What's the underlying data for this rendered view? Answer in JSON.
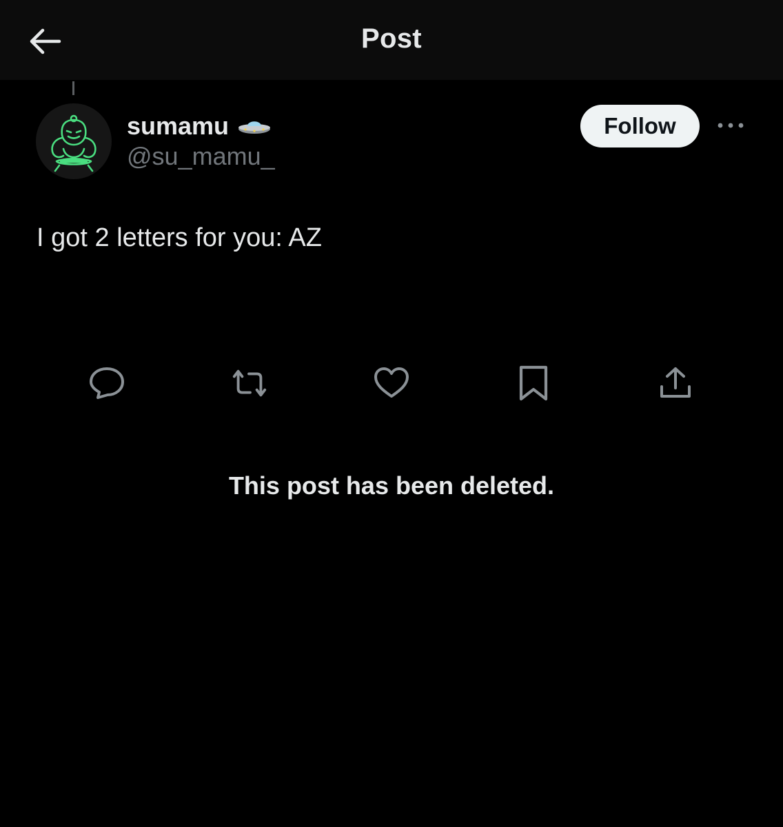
{
  "header": {
    "title": "Post",
    "back_icon": "arrow-left-icon"
  },
  "post": {
    "author": {
      "display_name": "sumamu",
      "handle": "@su_mamu_",
      "badge_icon": "ufo-emoji-icon",
      "avatar_icon": "sumo-wrestler-avatar",
      "avatar_accent": "#4ade80"
    },
    "follow_label": "Follow",
    "more_icon": "more-dots-icon",
    "text": "I got 2 letters for you: AZ",
    "actions": [
      {
        "icon": "reply-icon"
      },
      {
        "icon": "repost-icon"
      },
      {
        "icon": "like-icon"
      },
      {
        "icon": "bookmark-icon"
      },
      {
        "icon": "share-icon"
      }
    ]
  },
  "notice": "This post has been deleted.",
  "colors": {
    "background": "#000000",
    "header_background": "#0c0c0c",
    "primary_text": "#e7e9ea",
    "secondary_text": "#71767b",
    "icon": "#8b9196",
    "follow_button": "#eff3f4"
  }
}
